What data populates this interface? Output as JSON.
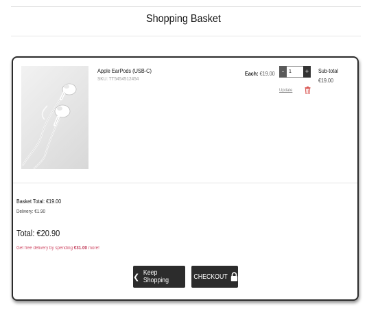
{
  "page": {
    "title": "Shopping Basket"
  },
  "item": {
    "name": "Apple EarPods (USB-C)",
    "sku": "SKU: TT5454512454",
    "each_label": "Each:",
    "each_price": "€19.00",
    "quantity": "1",
    "minus": "-",
    "plus": "+",
    "update_label": "Update",
    "subtotal_label": "Sub-total",
    "subtotal_value": "€19.00"
  },
  "summary": {
    "basket_total": "Basket Total: €19.00",
    "delivery": "Delivery: €1.90",
    "total": "Total: €20.90",
    "free_prefix": "Get free delivery by spending ",
    "free_amount": "€31.00",
    "free_suffix": " more!"
  },
  "actions": {
    "keep_shopping": "Keep Shopping",
    "checkout": "CHECKOUT"
  },
  "icons": {
    "back": "chevron-left-icon",
    "delete": "trash-icon",
    "checkout": "lock-icon"
  },
  "colors": {
    "button_bg": "#2c2c2c",
    "delete_red": "#d9534f",
    "free_text": "#d0506a"
  }
}
